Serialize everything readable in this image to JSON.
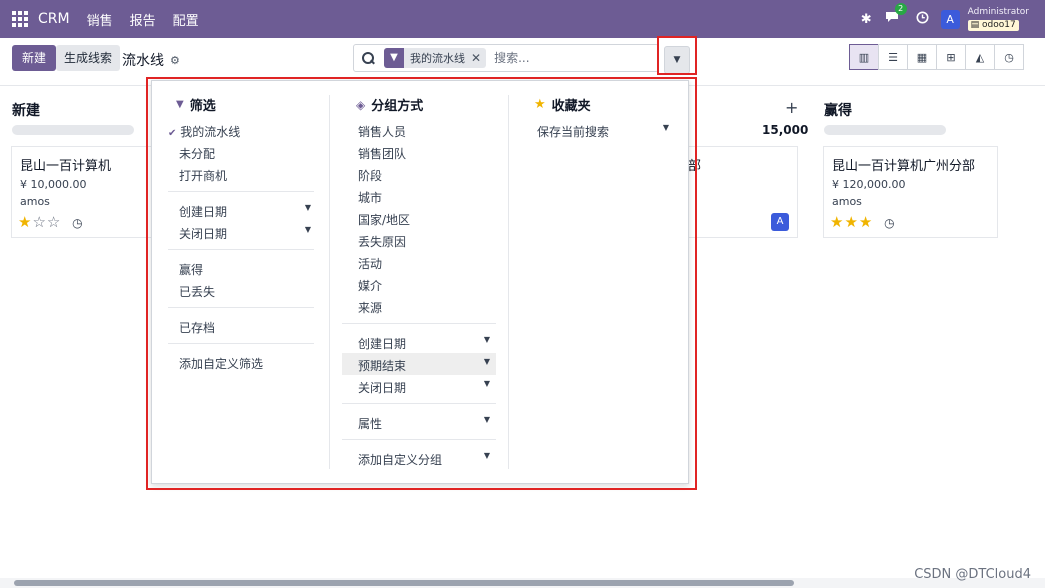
{
  "navbar": {
    "brand": "CRM",
    "menu": [
      "销售",
      "报告",
      "配置"
    ],
    "chat_badge": "2",
    "avatar_letter": "A",
    "user_name": "Administrator",
    "db_name": "odoo17"
  },
  "control": {
    "new_label": "新建",
    "generate_label": "生成线索",
    "breadcrumb": "流水线",
    "search_facet": "我的流水线",
    "search_placeholder": "搜索..."
  },
  "kanban": {
    "columns": [
      {
        "title": "新建"
      },
      {
        "title": "赢得"
      }
    ],
    "partial_total": "15,000",
    "partial_card_text": "部",
    "cards": [
      {
        "title": "昆山一百计算机",
        "revenue": "¥ 10,000.00",
        "owner": "amos",
        "stars": 1
      },
      {
        "title": "昆山一百计算机广州分部",
        "revenue": "¥ 120,000.00",
        "owner": "amos",
        "stars": 3
      }
    ],
    "card_avatar": "A"
  },
  "dropdown": {
    "filters": {
      "title": "筛选",
      "items": [
        "我的流水线",
        "未分配",
        "打开商机"
      ],
      "date_items": [
        "创建日期",
        "关闭日期"
      ],
      "status_items": [
        "赢得",
        "已丢失"
      ],
      "archived": "已存档",
      "custom": "添加自定义筛选"
    },
    "group_by": {
      "title": "分组方式",
      "items": [
        "销售人员",
        "销售团队",
        "阶段",
        "城市",
        "国家/地区",
        "丢失原因",
        "活动",
        "媒介",
        "来源"
      ],
      "date_items": [
        "创建日期",
        "预期结束",
        "关闭日期"
      ],
      "property": "属性",
      "custom": "添加自定义分组"
    },
    "favorites": {
      "title": "收藏夹",
      "save": "保存当前搜索"
    }
  },
  "footer": {
    "watermark": "CSDN @DTCloud4"
  },
  "colors": {
    "brand": "#6d5c94",
    "star": "#f0b400",
    "annotation": "#e02424"
  }
}
